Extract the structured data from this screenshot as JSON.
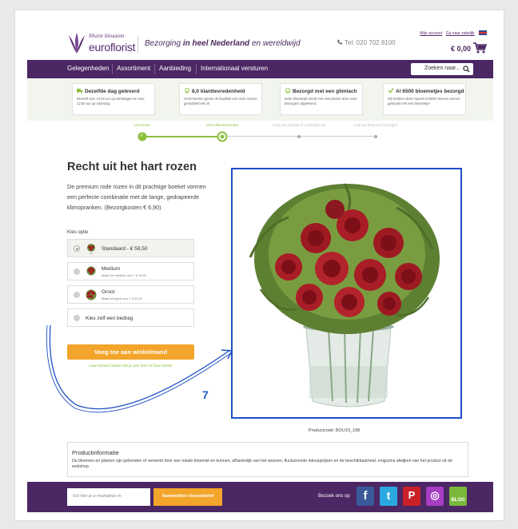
{
  "header": {
    "logo_tagline": "Share blossom",
    "logo_name": "euroflorist",
    "tagline_pre": "Bezorging ",
    "tagline_bold": "in heel Nederland",
    "tagline_post": " en wereldwijd",
    "phone": "Tel: 020 702 8100",
    "my_account": "Mijn account",
    "go_cart": "Ga naar zakelijk",
    "cart_total": "€ 0,00"
  },
  "nav": {
    "items": [
      "Gelegenheden",
      "Assortiment",
      "Aanbieding",
      "Internationaal versturen"
    ],
    "search_placeholder": "Zoeken naar..."
  },
  "usps": [
    {
      "title": "Dezelfde dag geleverd",
      "desc": "Besteld voor 14:00 uur op werkdagen en voor 12:00 uur op zaterdag.",
      "icon": "truck-icon"
    },
    {
      "title": "8,0 klanttevredenheid",
      "desc": "Onze klanten geven de kwaliteit van onze service gemiddeld een 8!",
      "icon": "award-icon"
    },
    {
      "title": "Bezorgd met een glimlach",
      "desc": "Ieder bloemetje wordt met veel plezier door onze bezorgers afgeleverd.",
      "icon": "smile-icon"
    },
    {
      "title": "Al 6500 bloemetjes bezorgd",
      "desc": "Wij hebben deze maand al 6500 mensen verrast gemaakt met een bloemetje!",
      "icon": "check-icon"
    }
  ],
  "steps": [
    {
      "label": "Uw keuze",
      "state": "done"
    },
    {
      "label": "Kies aflevermoment",
      "state": "current"
    },
    {
      "label": "Voeg een kaartje of cadeautje toe",
      "state": "todo"
    },
    {
      "label": "Laat uw bloemen bezorgen",
      "state": "todo"
    }
  ],
  "product": {
    "title": "Recht uit het hart rozen",
    "description": "De premium rode rozen in dit prachtige boeket vormen een perfecte combinatie met de lange, gedrapeerde klimopranken. (Bezorgkosten € 6,90)",
    "options_label": "Kies optie",
    "options": [
      {
        "name": "Standaard - € 59,50",
        "sub": "",
        "selected": true
      },
      {
        "name": "Medium",
        "sub": "Maak het medium voor + € 10,00",
        "selected": false
      },
      {
        "name": "Groot",
        "sub": "Maak het groot voor + € 20,00",
        "selected": false
      },
      {
        "name": "Kies zelf een bedrag",
        "sub": "",
        "selected": false
      }
    ],
    "add_button": "Voeg toe aan winkelmand",
    "let_know": "Laat iemand weten dat je aan hem of haar denkt!",
    "annotation_number": "7",
    "product_code": "Productcode: BOU10_168"
  },
  "info": {
    "title": "Productinformatie",
    "text": "De bloemen en planten zijn gebonden of verwerkt door een lokale bloemist en kunnen, afhankelijk van het seizoen, fluctuerende inkoopprijzen en de beschikbaarheid, enigszins afwijken van het product uit de webshop."
  },
  "footer": {
    "newsletter_placeholder": "Vul hier je e-mailadres in",
    "newsletter_button": "Aanmelden nieuwsbrief",
    "visit_label": "Bezoek ons op",
    "social": [
      {
        "name": "facebook-icon",
        "glyph": "f",
        "color": "#3b5998"
      },
      {
        "name": "twitter-icon",
        "glyph": "t",
        "color": "#2aa9e0"
      },
      {
        "name": "pinterest-icon",
        "glyph": "P",
        "color": "#cb2027"
      },
      {
        "name": "instagram-icon",
        "glyph": "◎",
        "color": "#a73ec3"
      },
      {
        "name": "blog-icon",
        "glyph": "BLOG",
        "color": "#7ab83a"
      }
    ]
  },
  "colors": {
    "brand_purple": "#4b2764",
    "accent_orange": "#f2a52a",
    "accent_green": "#8bbf3c",
    "annotation_blue": "#1e4fc4"
  }
}
